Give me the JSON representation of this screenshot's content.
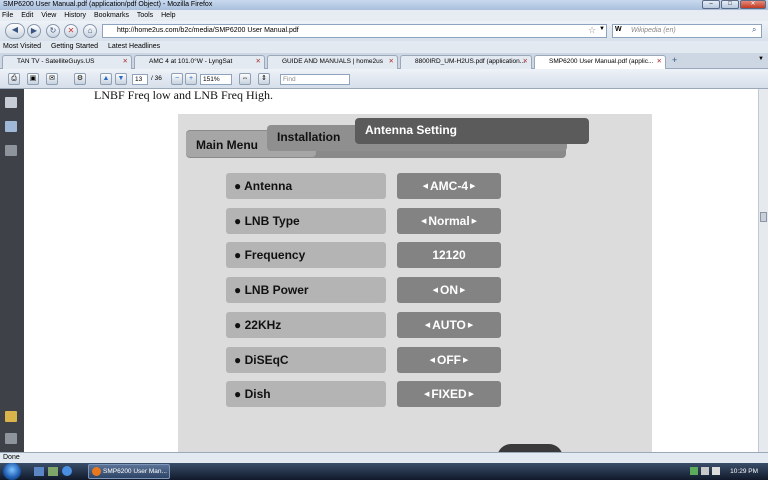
{
  "window": {
    "title": "SMP6200 User Manual.pdf (application/pdf Object) - Mozilla Firefox"
  },
  "menu": [
    "File",
    "Edit",
    "View",
    "History",
    "Bookmarks",
    "Tools",
    "Help"
  ],
  "nav": {
    "url": "http://home2us.com/b2c/media/SMP6200 User Manual.pdf",
    "search_placeholder": "Wikipedia (en)",
    "search_engine_label": "W"
  },
  "bookmarks": [
    "Most Visited",
    "Getting Started",
    "Latest Headlines"
  ],
  "tabs": [
    {
      "label": "TAN TV - SatelliteGuys.US"
    },
    {
      "label": "AMC 4 at 101.0°W - LyngSat"
    },
    {
      "label": "GUIDE AND MANUALS | home2us"
    },
    {
      "label": "8800IRD_UM-H2US.pdf (application..."
    },
    {
      "label": "SMP6200 User Manual.pdf (applic..."
    }
  ],
  "pdf": {
    "page": "13",
    "page_total": "/ 36",
    "zoom": "151%",
    "find_placeholder": "Find"
  },
  "doc": {
    "text": "LNBF Freq low and LNB Freq High."
  },
  "tv": {
    "tabs": {
      "main": "Main Menu",
      "installation": "Installation",
      "antenna": "Antenna Setting"
    },
    "rows": [
      {
        "label": "Antenna",
        "value": "AMC-4",
        "arrows": true
      },
      {
        "label": "LNB Type",
        "value": "Normal",
        "arrows": true
      },
      {
        "label": "Frequency",
        "value": "12120",
        "arrows": false
      },
      {
        "label": "LNB Power",
        "value": "ON",
        "arrows": true
      },
      {
        "label": "22KHz",
        "value": "AUTO",
        "arrows": true
      },
      {
        "label": "DiSEqC",
        "value": "OFF",
        "arrows": true
      },
      {
        "label": "Dish",
        "value": "FIXED",
        "arrows": true
      }
    ]
  },
  "status": {
    "text": "Done"
  },
  "taskbar": {
    "item": "SMP6200 User Man...",
    "clock": "10:29 PM"
  }
}
